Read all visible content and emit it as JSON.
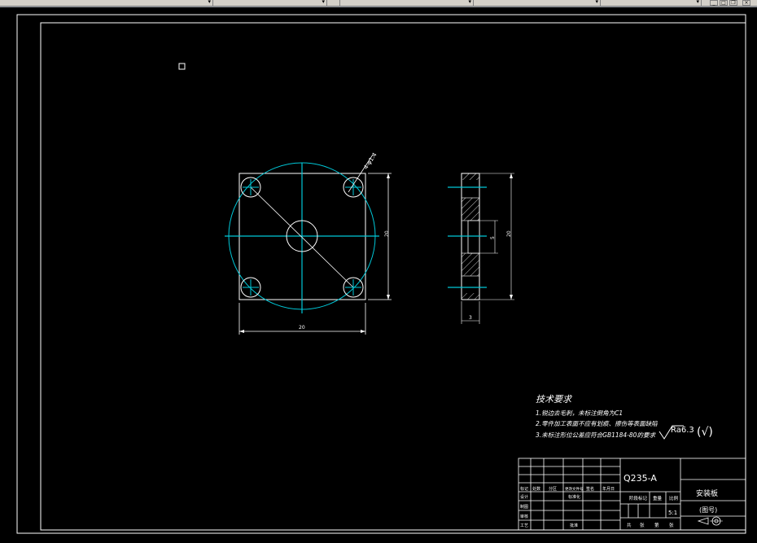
{
  "drawing": {
    "tech_requirements": {
      "title": "技术要求",
      "items": [
        "1.锐边去毛刺，未标注倒角为C1",
        "2.零件加工表面不应有划痕、擦伤等表面缺陷",
        "3.未标注形位公差应符合GB1184-80的要求"
      ]
    },
    "roughness": {
      "label": "Ra6.3",
      "paren": "(√)"
    },
    "title_block": {
      "material": "Q235-A",
      "part_name": "安装板",
      "drawing_no": "(图号)",
      "scale": "5:1",
      "row_labels": [
        "标记",
        "设计",
        "制图",
        "审核",
        "工艺"
      ],
      "header_cells": [
        "标记",
        "处数",
        "分区",
        "更改文件号",
        "签名",
        "年月日"
      ],
      "std_label": "标准化",
      "approve_label": "批准",
      "stage_label": "阶段标记",
      "weight_label": "重量",
      "scale_label": "比例",
      "sheet_total": "共",
      "sheet_unit_1": "张",
      "sheet_no": "第",
      "sheet_unit_2": "张"
    },
    "dims": {
      "width": "20",
      "height": "20",
      "bore": "5",
      "side_height": "20",
      "thickness": "3",
      "hole_callout": "4-φ1.4"
    },
    "colors": {
      "background": "#000000",
      "line": "#ffffff",
      "centerline": "#00c8d8"
    }
  }
}
